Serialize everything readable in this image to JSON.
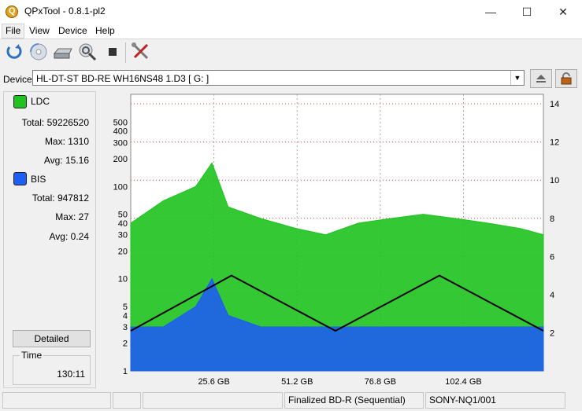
{
  "window": {
    "title": "QPxTool - 0.8.1-pl2"
  },
  "menu": [
    "File",
    "View",
    "Device",
    "Help"
  ],
  "toolbar": {
    "icons": [
      "refresh-icon",
      "disc-icon",
      "drive-icon",
      "scan-icon",
      "stop-icon",
      "settings-icon"
    ]
  },
  "device": {
    "label": "Device:",
    "value": "HL-DT-ST BD-RE  WH16NS48  1.D3 [ G: ]"
  },
  "ldc": {
    "name": "LDC",
    "color": "#1fc21f",
    "total_label": "Total:",
    "total": "59226520",
    "max_label": "Max:",
    "max": "1310",
    "avg_label": "Avg:",
    "avg": "15.16"
  },
  "bis": {
    "name": "BIS",
    "color": "#1e5ef0",
    "total_label": "Total:",
    "total": "947812",
    "max_label": "Max:",
    "max": "27",
    "avg_label": "Avg:",
    "avg": "0.24"
  },
  "buttons": {
    "detailed": "Detailed"
  },
  "time": {
    "label": "Time",
    "value": "130:11"
  },
  "status": {
    "cell1": "",
    "cell2": "",
    "disc": "Finalized BD-R (Sequential)",
    "media": "SONY-NQ1/001"
  },
  "chart_data": {
    "type": "area",
    "xticks": [
      "25.6 GB",
      "51.2 GB",
      "76.8 GB",
      "102.4 GB"
    ],
    "x_tick_values": [
      25.6,
      51.2,
      76.8,
      102.4
    ],
    "xlim": [
      0,
      127
    ],
    "left_axis": {
      "scale": "log",
      "ylim": [
        1,
        1000
      ],
      "ticks": [
        "1",
        "2",
        "3",
        "4",
        "5",
        "10",
        "20",
        "30",
        "40",
        "50",
        "100",
        "200",
        "300",
        "400",
        "500"
      ]
    },
    "right_axis": {
      "ylim": [
        0,
        14.5
      ],
      "ticks": [
        "2",
        "4",
        "6",
        "8",
        "10",
        "12",
        "14"
      ]
    },
    "series": [
      {
        "name": "LDC",
        "color": "#1fc21f",
        "x": [
          0,
          10,
          20,
          25,
          30,
          40,
          51,
          60,
          70,
          80,
          90,
          100,
          110,
          120,
          127
        ],
        "values": [
          40,
          70,
          100,
          180,
          60,
          45,
          35,
          30,
          40,
          45,
          50,
          45,
          40,
          35,
          30
        ]
      },
      {
        "name": "BIS",
        "color": "#1e5ef0",
        "x": [
          0,
          10,
          20,
          25,
          30,
          40,
          51,
          60,
          70,
          80,
          90,
          100,
          110,
          120,
          127
        ],
        "values": [
          3,
          3,
          5,
          10,
          4,
          3,
          3,
          3,
          3,
          3,
          3,
          3,
          3,
          3,
          3
        ]
      },
      {
        "name": "Speed",
        "color": "#000000",
        "x": [
          0,
          31,
          63,
          95,
          127
        ],
        "values": [
          2.1,
          5,
          2.1,
          5,
          2.1
        ]
      }
    ]
  }
}
